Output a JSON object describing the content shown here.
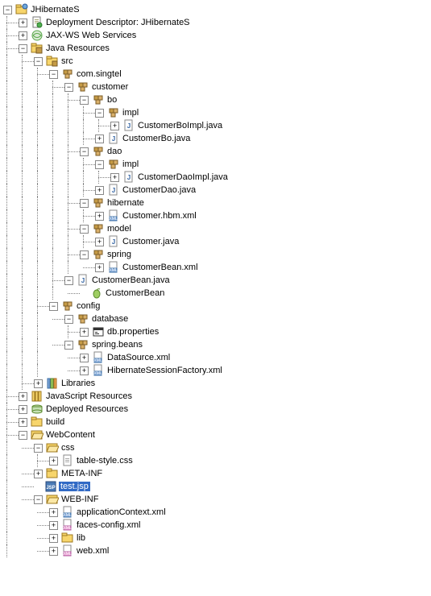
{
  "tree": [
    {
      "d": 0,
      "t": "minus",
      "i": "project",
      "lbl": "JHibernateS"
    },
    {
      "d": 1,
      "t": "plus",
      "i": "desc",
      "lbl": "Deployment Descriptor: JHibernateS"
    },
    {
      "d": 1,
      "t": "plus",
      "i": "jaxws",
      "lbl": "JAX-WS Web Services"
    },
    {
      "d": 1,
      "t": "minus",
      "i": "src-root",
      "lbl": "Java Resources"
    },
    {
      "d": 2,
      "t": "minus",
      "i": "src-folder",
      "lbl": "src"
    },
    {
      "d": 3,
      "t": "minus",
      "i": "package",
      "lbl": "com.singtel"
    },
    {
      "d": 4,
      "t": "minus",
      "i": "package",
      "lbl": "customer"
    },
    {
      "d": 5,
      "t": "minus",
      "i": "package",
      "lbl": "bo"
    },
    {
      "d": 6,
      "t": "minus",
      "i": "package",
      "lbl": "impl"
    },
    {
      "d": 7,
      "t": "plus",
      "i": "java",
      "lbl": "CustomerBoImpl.java"
    },
    {
      "d": 6,
      "t": "plus",
      "i": "java",
      "lbl": "CustomerBo.java",
      "last": true
    },
    {
      "d": 5,
      "t": "minus",
      "i": "package",
      "lbl": "dao"
    },
    {
      "d": 6,
      "t": "minus",
      "i": "package",
      "lbl": "impl"
    },
    {
      "d": 7,
      "t": "plus",
      "i": "java",
      "lbl": "CustomerDaoImpl.java"
    },
    {
      "d": 6,
      "t": "plus",
      "i": "java",
      "lbl": "CustomerDao.java",
      "last": true
    },
    {
      "d": 5,
      "t": "minus",
      "i": "package",
      "lbl": "hibernate"
    },
    {
      "d": 6,
      "t": "plus",
      "i": "xml",
      "lbl": "Customer.hbm.xml",
      "last": true
    },
    {
      "d": 5,
      "t": "minus",
      "i": "package",
      "lbl": "model"
    },
    {
      "d": 6,
      "t": "plus",
      "i": "java",
      "lbl": "Customer.java",
      "last": true
    },
    {
      "d": 5,
      "t": "minus",
      "i": "package",
      "lbl": "spring",
      "last": true
    },
    {
      "d": 6,
      "t": "plus",
      "i": "xml",
      "lbl": "CustomerBean.xml",
      "last": true
    },
    {
      "d": 4,
      "t": "minus",
      "i": "java",
      "lbl": "CustomerBean.java",
      "last": true
    },
    {
      "d": 5,
      "t": "none",
      "i": "bean",
      "lbl": "CustomerBean",
      "last": true
    },
    {
      "d": 3,
      "t": "minus",
      "i": "package",
      "lbl": "config",
      "last": true
    },
    {
      "d": 4,
      "t": "minus",
      "i": "package",
      "lbl": "database"
    },
    {
      "d": 5,
      "t": "plus",
      "i": "props",
      "lbl": "db.properties",
      "last": true
    },
    {
      "d": 4,
      "t": "minus",
      "i": "package",
      "lbl": "spring.beans",
      "last": true
    },
    {
      "d": 5,
      "t": "plus",
      "i": "xml",
      "lbl": "DataSource.xml"
    },
    {
      "d": 5,
      "t": "plus",
      "i": "xml",
      "lbl": "HibernateSessionFactory.xml",
      "last": true
    },
    {
      "d": 2,
      "t": "plus",
      "i": "lib",
      "lbl": "Libraries",
      "last": true
    },
    {
      "d": 1,
      "t": "plus",
      "i": "js-lib",
      "lbl": "JavaScript Resources"
    },
    {
      "d": 1,
      "t": "plus",
      "i": "deployed",
      "lbl": "Deployed Resources"
    },
    {
      "d": 1,
      "t": "plus",
      "i": "folder",
      "lbl": "build"
    },
    {
      "d": 1,
      "t": "minus",
      "i": "folder-open",
      "lbl": "WebContent",
      "last": true
    },
    {
      "d": 2,
      "t": "minus",
      "i": "folder-open",
      "lbl": "css"
    },
    {
      "d": 3,
      "t": "plus",
      "i": "file",
      "lbl": "table-style.css",
      "last": true
    },
    {
      "d": 2,
      "t": "plus",
      "i": "folder",
      "lbl": "META-INF"
    },
    {
      "d": 2,
      "t": "none",
      "i": "jsp",
      "lbl": "test.jsp",
      "selected": true
    },
    {
      "d": 2,
      "t": "minus",
      "i": "folder-open",
      "lbl": "WEB-INF",
      "last": true
    },
    {
      "d": 3,
      "t": "plus",
      "i": "xml",
      "lbl": "applicationContext.xml"
    },
    {
      "d": 3,
      "t": "plus",
      "i": "xml-pink",
      "lbl": "faces-config.xml"
    },
    {
      "d": 3,
      "t": "plus",
      "i": "folder",
      "lbl": "lib"
    },
    {
      "d": 3,
      "t": "plus",
      "i": "xml-pink",
      "lbl": "web.xml",
      "last": true
    }
  ]
}
